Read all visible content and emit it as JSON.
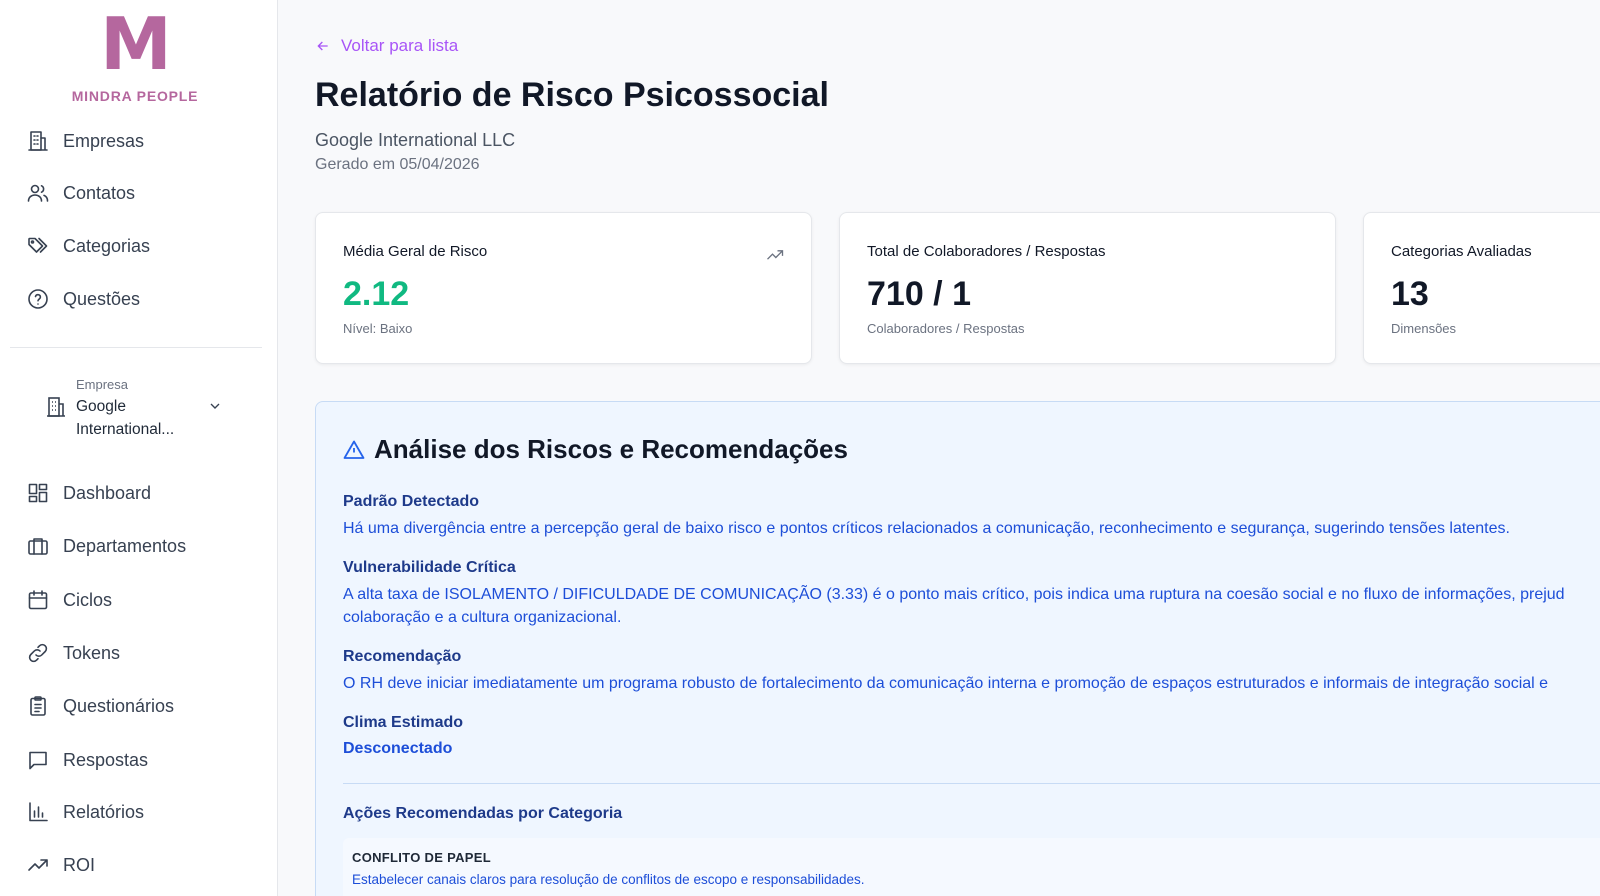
{
  "brand": {
    "logo_letter": "M",
    "name": "MINDRA PEOPLE",
    "color": "#b5679e"
  },
  "sidebar": {
    "top_items": [
      {
        "label": "Empresas",
        "icon": "building-icon"
      },
      {
        "label": "Contatos",
        "icon": "users-icon"
      },
      {
        "label": "Categorias",
        "icon": "tags-icon"
      },
      {
        "label": "Questões",
        "icon": "help-circle-icon"
      }
    ],
    "company_selector": {
      "caption": "Empresa",
      "value": "Google International..."
    },
    "items": [
      {
        "label": "Dashboard",
        "icon": "dashboard-icon"
      },
      {
        "label": "Departamentos",
        "icon": "briefcase-icon"
      },
      {
        "label": "Ciclos",
        "icon": "calendar-icon"
      },
      {
        "label": "Tokens",
        "icon": "link-icon"
      },
      {
        "label": "Questionários",
        "icon": "clipboard-icon"
      },
      {
        "label": "Respostas",
        "icon": "message-square-icon"
      },
      {
        "label": "Relatórios",
        "icon": "bar-chart-icon"
      },
      {
        "label": "ROI",
        "icon": "trending-up-icon"
      }
    ]
  },
  "header": {
    "back_label": "Voltar para lista",
    "title": "Relatório de Risco Psicossocial",
    "company": "Google International LLC",
    "generated": "Gerado em 05/04/2026"
  },
  "cards": [
    {
      "title": "Média Geral de Risco",
      "value": "2.12",
      "sub": "Nível: Baixo",
      "value_color": "#10b981",
      "icon": "trending-up-icon"
    },
    {
      "title": "Total de Colaboradores / Respostas",
      "value": "710 / 1",
      "sub": "Colaboradores / Respostas"
    },
    {
      "title": "Categorias Avaliadas",
      "value": "13",
      "sub": "Dimensões"
    }
  ],
  "analysis": {
    "title": "Análise dos Riscos e Recomendações",
    "icon": "alert-triangle-icon",
    "pattern_label": "Padrão Detectado",
    "pattern_text": "Há uma divergência entre a percepção geral de baixo risco e pontos críticos relacionados a comunicação, reconhecimento e segurança, sugerindo tensões latentes.",
    "vulnerability_label": "Vulnerabilidade Crítica",
    "vulnerability_text": "A alta taxa de ISOLAMENTO / DIFICULDADE DE COMUNICAÇÃO (3.33) é o ponto mais crítico, pois indica uma ruptura na coesão social e no fluxo de informações, prejud",
    "vulnerability_text_2": "colaboração e a cultura organizacional.",
    "recommendation_label": "Recomendação",
    "recommendation_text": "O RH deve iniciar imediatamente um programa robusto de fortalecimento da comunicação interna e promoção de espaços estruturados e informais de integração social e",
    "climate_label": "Clima Estimado",
    "climate_value": "Desconectado",
    "actions_title": "Ações Recomendadas por Categoria",
    "actions": [
      {
        "category": "CONFLITO DE PAPEL",
        "description": "Estabelecer canais claros para resolução de conflitos de escopo e responsabilidades."
      }
    ]
  }
}
